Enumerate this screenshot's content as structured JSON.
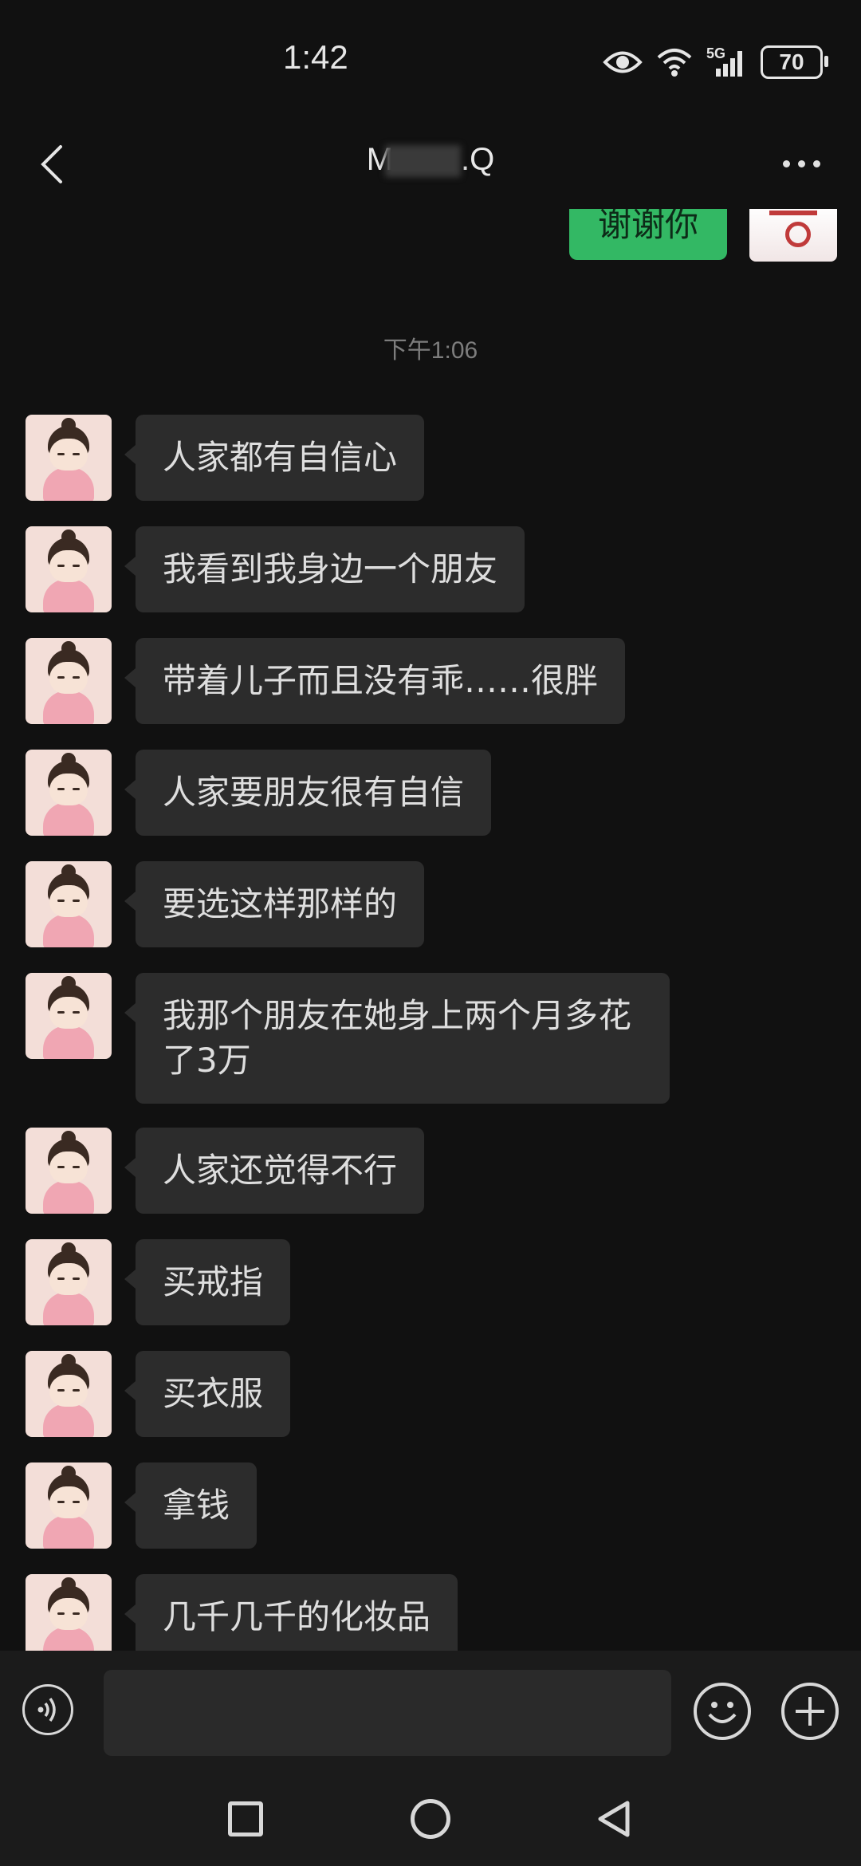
{
  "status_bar": {
    "time": "1:42",
    "network": "5G",
    "battery": "70"
  },
  "header": {
    "title_visible_prefix": "M",
    "title_visible_suffix": ".Q"
  },
  "chat": {
    "sent_partial": "谢谢你",
    "timestamp": "下午1:06",
    "messages": [
      "人家都有自信心",
      "我看到我身边一个朋友",
      "带着儿子而且没有乖……很胖",
      "人家要朋友很有自信",
      "要选这样那样的",
      "我那个朋友在她身上两个月多花了3万",
      "人家还觉得不行",
      "买戒指",
      "买衣服",
      "拿钱",
      "几千几千的化妆品"
    ]
  },
  "input": {
    "value": "",
    "placeholder": ""
  },
  "colors": {
    "background": "#111111",
    "sent_bubble": "#33b864",
    "received_bubble": "#2c2c2c"
  },
  "icons": [
    "eye-icon",
    "wifi-icon",
    "signal-icon",
    "battery-icon",
    "back-icon",
    "more-icon",
    "voice-icon",
    "emoji-icon",
    "plus-icon",
    "recent-apps-icon",
    "home-icon",
    "system-back-icon"
  ]
}
